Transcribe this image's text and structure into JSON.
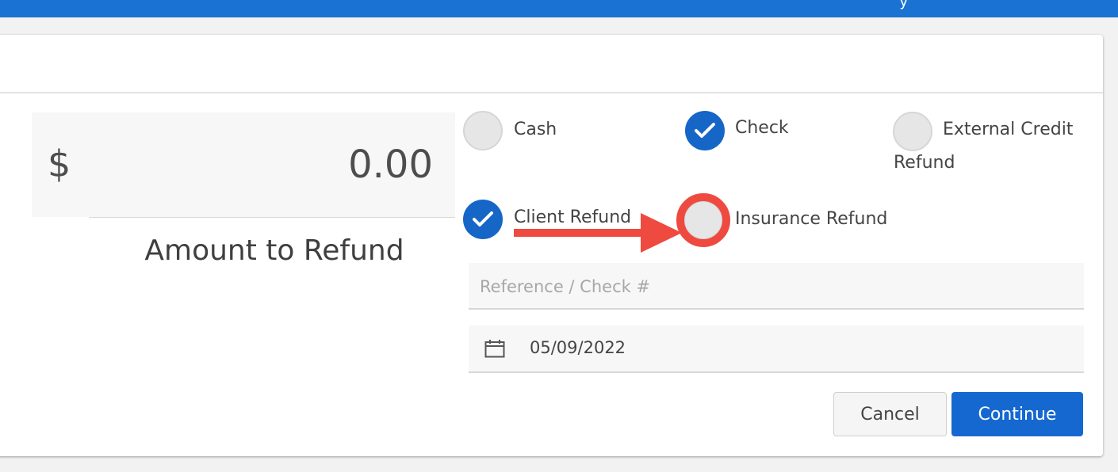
{
  "topbar": {
    "glyph": "y",
    "color": "#1a72d2"
  },
  "amount": {
    "currency_symbol": "$",
    "value": "0.00",
    "label": "Amount to Refund"
  },
  "payment_methods": {
    "cash": {
      "label": "Cash",
      "checked": false
    },
    "check": {
      "label": "Check",
      "checked": true
    },
    "external_credit": {
      "label_line1": "External Credit",
      "label_line2": "Refund",
      "checked": false
    },
    "client_refund": {
      "label": "Client Refund",
      "checked": true
    },
    "insurance_refund": {
      "label": "Insurance Refund",
      "checked": false
    }
  },
  "reference": {
    "placeholder": "Reference / Check #",
    "value": ""
  },
  "date": {
    "value": "05/09/2022",
    "icon": "calendar-icon"
  },
  "buttons": {
    "cancel": "Cancel",
    "continue": "Continue"
  },
  "colors": {
    "accent": "#1568d0",
    "checked": "#1566c7",
    "annotation": "#ee4a40"
  }
}
